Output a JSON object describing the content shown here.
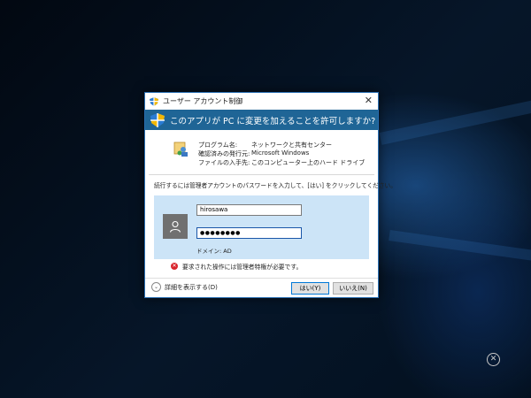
{
  "dialog": {
    "title": "ユーザー アカウント制御",
    "close_glyph": "✕",
    "question": "このアプリが PC に変更を加えることを許可しますか?",
    "program_label": "プログラム名:",
    "program_value": "ネットワークと共有センター",
    "publisher_label": "確認済みの発行元:",
    "publisher_value": "Microsoft Windows",
    "origin_label": "ファイルの入手先:",
    "origin_value": "このコンピューター上のハード ドライブ",
    "instruction": "続行するには管理者アカウントのパスワードを入力して、[はい] をクリックしてください。",
    "username_value": "hirosawa",
    "password_mask": "●●●●●●●●",
    "domain_text": "ドメイン: AD",
    "error_text": "要求された操作には管理者特権が必要です。",
    "details_label": "詳細を表示する(D)",
    "yes_label": "はい(Y)",
    "no_label": "いいえ(N)"
  },
  "desktop": {
    "close_glyph": "✕"
  },
  "colors": {
    "header_bg": "#1f6596",
    "credential_bg": "#cce4f7",
    "error_red": "#d9262d"
  }
}
